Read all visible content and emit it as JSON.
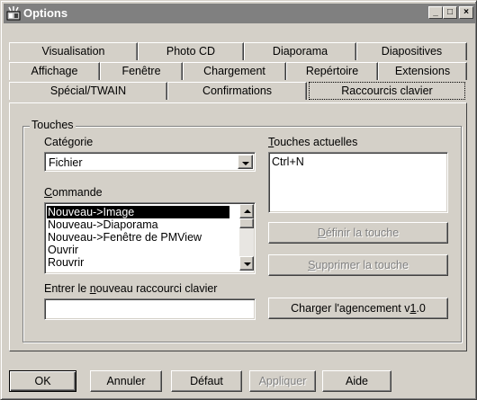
{
  "window": {
    "title": "Options",
    "controls": {
      "minimize": "_",
      "maximize": "□",
      "close": "×"
    }
  },
  "tabs": {
    "row1": [
      "Visualisation",
      "Photo CD",
      "Diaporama",
      "Diapositives"
    ],
    "row2": [
      "Affichage",
      "Fenêtre",
      "Chargement",
      "Repértoire",
      "Extensions"
    ],
    "row3": [
      "Spécial/TWAIN",
      "Confirmations",
      "Raccourcis clavier"
    ],
    "active": "Raccourcis clavier"
  },
  "group": {
    "legend": "Touches",
    "category_label_pre": "Caté",
    "category_label_u": "g",
    "category_label_post": "orie",
    "category_value": "Fichier",
    "command_label_u": "C",
    "command_label_post": "ommande",
    "commands": [
      "Nouveau->Image",
      "Nouveau->Diaporama",
      "Nouveau->Fenêtre de PMView",
      "Ouvrir",
      "Rouvrir"
    ],
    "selected_command": "Nouveau->Image",
    "current_keys_label_u": "T",
    "current_keys_label_post": "ouches actuelles",
    "current_keys": [
      "Ctrl+N"
    ],
    "define_key_pre": "",
    "define_key_u": "D",
    "define_key_post": "éfinir la touche",
    "remove_key_u": "S",
    "remove_key_post": "upprimer la touche",
    "new_shortcut_label_pre": "Entrer le ",
    "new_shortcut_label_u": "n",
    "new_shortcut_label_post": "ouveau raccourci clavier",
    "new_shortcut_value": "",
    "load_layout_pre": "Charger l'agencement v",
    "load_layout_u": "1",
    "load_layout_post": ".0"
  },
  "footer": {
    "ok": "OK",
    "cancel": "Annuler",
    "default": "Défaut",
    "apply": "Appliquer",
    "help": "Aide"
  }
}
